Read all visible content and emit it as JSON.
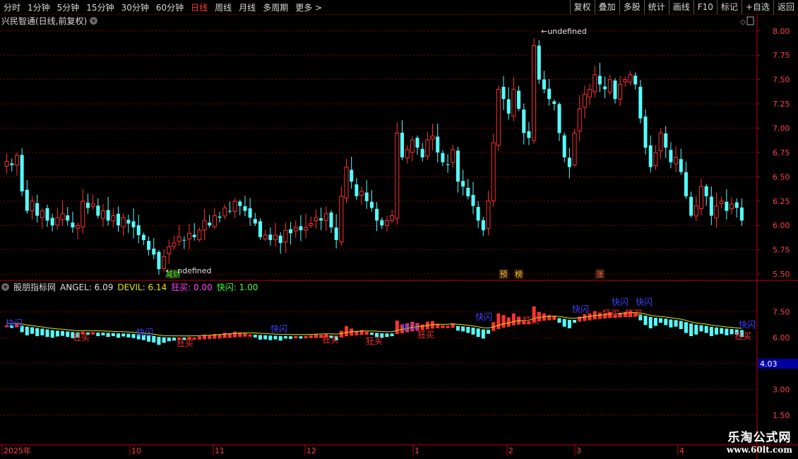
{
  "toolbar": {
    "periods": [
      "分时",
      "1分钟",
      "5分钟",
      "15分钟",
      "30分钟",
      "60分钟",
      "日线",
      "周线",
      "月线",
      "多周期",
      "更多 >"
    ],
    "active_index": 6,
    "right_buttons": [
      "复权",
      "叠加",
      "多股",
      "统计",
      "画线",
      "F10",
      "标记",
      "+自选",
      "返回"
    ]
  },
  "main": {
    "title": "兴民智通(日线,前复权)",
    "max_label": "7.99",
    "min_label": "5.53",
    "badges": [
      "减财",
      "预",
      "榜",
      "涨"
    ]
  },
  "indicator": {
    "name": "股朋指标网",
    "angel_label": "ANGEL: 6.09",
    "devil_label": "DEVIL: 6.14",
    "kuangmai_label": "狂买: 0.00",
    "kuaishan_label": "快闪: 1.00",
    "kuaishan_text": "快闪",
    "kuangmai_text": "狂买",
    "current_marker": "4.03"
  },
  "x_axis": {
    "labels": [
      "2025年",
      "10",
      "11",
      "12",
      "1",
      "2",
      "3",
      "4"
    ]
  },
  "colors": {
    "up": "#ff3232",
    "down": "#54ffff",
    "grid": "#800000",
    "axis": "#c00000",
    "devil": "#e6e600",
    "kuangmai": "#ff40ff",
    "kuaishan": "#40ff40"
  },
  "watermark": {
    "line1": "乐淘公式网",
    "line2": "www.60lt.com"
  },
  "chart_data": [
    {
      "type": "candlestick",
      "title": "兴民智通(日线,前复权)",
      "ylim": [
        5.45,
        8.1
      ],
      "y_ticks": [
        "8.00",
        "7.75",
        "7.50",
        "7.25",
        "7.00",
        "6.75",
        "6.50",
        "6.25",
        "6.00",
        "5.75",
        "5.50"
      ],
      "max_price": 7.99,
      "min_price": 5.53,
      "close_series": [
        6.66,
        6.62,
        6.72,
        6.35,
        6.15,
        6.25,
        6.1,
        6.15,
        6.05,
        6.0,
        6.08,
        6.12,
        6.05,
        5.98,
        6.0,
        6.25,
        6.18,
        6.22,
        6.1,
        6.15,
        6.05,
        6.1,
        6.0,
        6.08,
        6.02,
        5.98,
        5.9,
        5.85,
        5.75,
        5.7,
        5.55,
        5.68,
        5.78,
        5.82,
        5.88,
        5.85,
        5.92,
        5.88,
        5.95,
        6.05,
        6.0,
        6.1,
        6.08,
        6.18,
        6.15,
        6.25,
        6.2,
        6.15,
        6.08,
        6.02,
        5.88,
        5.9,
        5.85,
        5.9,
        5.82,
        5.95,
        5.92,
        5.98,
        5.95,
        5.98,
        6.02,
        6.08,
        6.05,
        6.12,
        5.98,
        5.85,
        6.3,
        6.6,
        6.45,
        6.3,
        6.35,
        6.25,
        6.18,
        6.05,
        6.0,
        6.05,
        6.1,
        6.95,
        6.7,
        6.78,
        6.88,
        6.8,
        6.7,
        6.88,
        6.92,
        6.75,
        6.65,
        6.62,
        6.78,
        6.45,
        6.4,
        6.3,
        6.2,
        6.05,
        5.95,
        6.25,
        6.85,
        7.4,
        7.3,
        7.15,
        7.4,
        7.2,
        6.95,
        6.9,
        7.85,
        7.5,
        7.4,
        7.3,
        7.25,
        6.95,
        6.7,
        6.6,
        6.95,
        7.2,
        7.35,
        7.4,
        7.55,
        7.45,
        7.4,
        7.5,
        7.3,
        7.45,
        7.5,
        7.55,
        7.45,
        7.1,
        6.8,
        6.6,
        6.75,
        6.95,
        6.8,
        6.65,
        6.7,
        6.55,
        6.3,
        6.1,
        6.2,
        6.4,
        6.3,
        6.1,
        6.2,
        6.25,
        6.15,
        6.22,
        6.18,
        6.05
      ]
    },
    {
      "type": "line",
      "title": "股朋指标网",
      "ylim": [
        1.0,
        8.8
      ],
      "y_ticks": [
        "7.50",
        "6.00",
        "4.50",
        "3.00",
        "1.50"
      ],
      "series": [
        {
          "name": "ANGEL",
          "last": 6.09
        },
        {
          "name": "DEVIL",
          "last": 6.14
        },
        {
          "name": "狂买",
          "last": 0.0
        },
        {
          "name": "快闪",
          "last": 1.0
        }
      ]
    }
  ]
}
